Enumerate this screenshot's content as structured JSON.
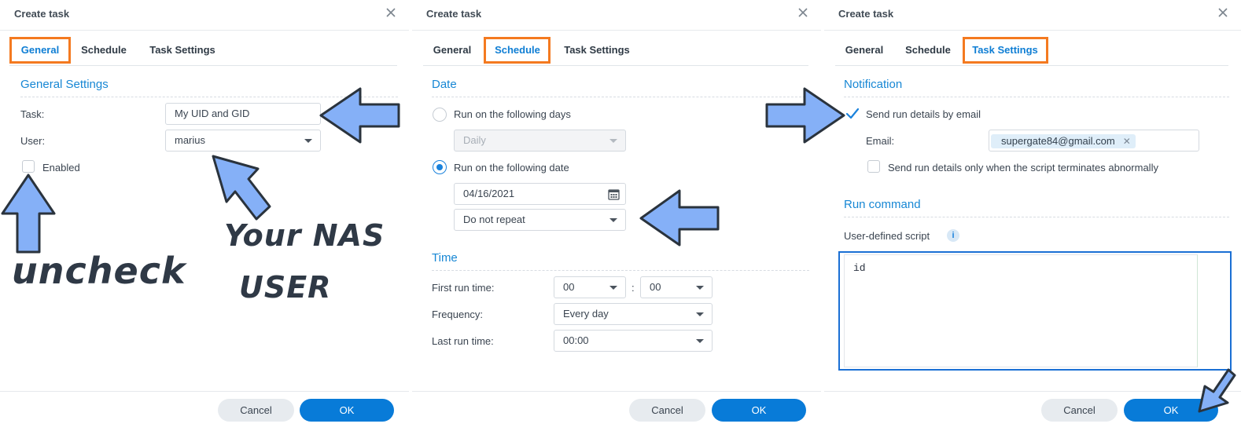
{
  "colors": {
    "accent": "#0f7ed4",
    "highlight_box": "#f47a20",
    "annotation_arrow": "#85b0f7",
    "ok_button": "#087bd8"
  },
  "dialog_title": "Create task",
  "tabs": {
    "general": "General",
    "schedule": "Schedule",
    "task_settings": "Task Settings"
  },
  "general": {
    "section_title": "General Settings",
    "task_label": "Task:",
    "task_value": "My UID and GID",
    "user_label": "User:",
    "user_value": "marius",
    "enabled_label": "Enabled",
    "enabled_checked": false,
    "annotation_uncheck": "uncheck",
    "annotation_nas_line1": "Your NAS",
    "annotation_nas_line2": "USER"
  },
  "schedule": {
    "date_section": "Date",
    "run_days_label": "Run on the following days",
    "days_value": "Daily",
    "run_date_label": "Run on the following date",
    "date_value": "04/16/2021",
    "repeat_value": "Do not repeat",
    "time_section": "Time",
    "first_run_label": "First run time:",
    "first_run_hour": "00",
    "first_run_minute": "00",
    "time_colon": ":",
    "frequency_label": "Frequency:",
    "frequency_value": "Every day",
    "last_run_label": "Last run time:",
    "last_run_value": "00:00"
  },
  "task_settings": {
    "notification_section": "Notification",
    "send_email_label": "Send run details by email",
    "send_email_checked": true,
    "email_label": "Email:",
    "email_chip": "supergate84@gmail.com",
    "abnormal_label": "Send run details only when the script terminates abnormally",
    "run_command_section": "Run command",
    "script_label": "User-defined script",
    "script_value": "id"
  },
  "footer": {
    "cancel": "Cancel",
    "ok": "OK"
  }
}
